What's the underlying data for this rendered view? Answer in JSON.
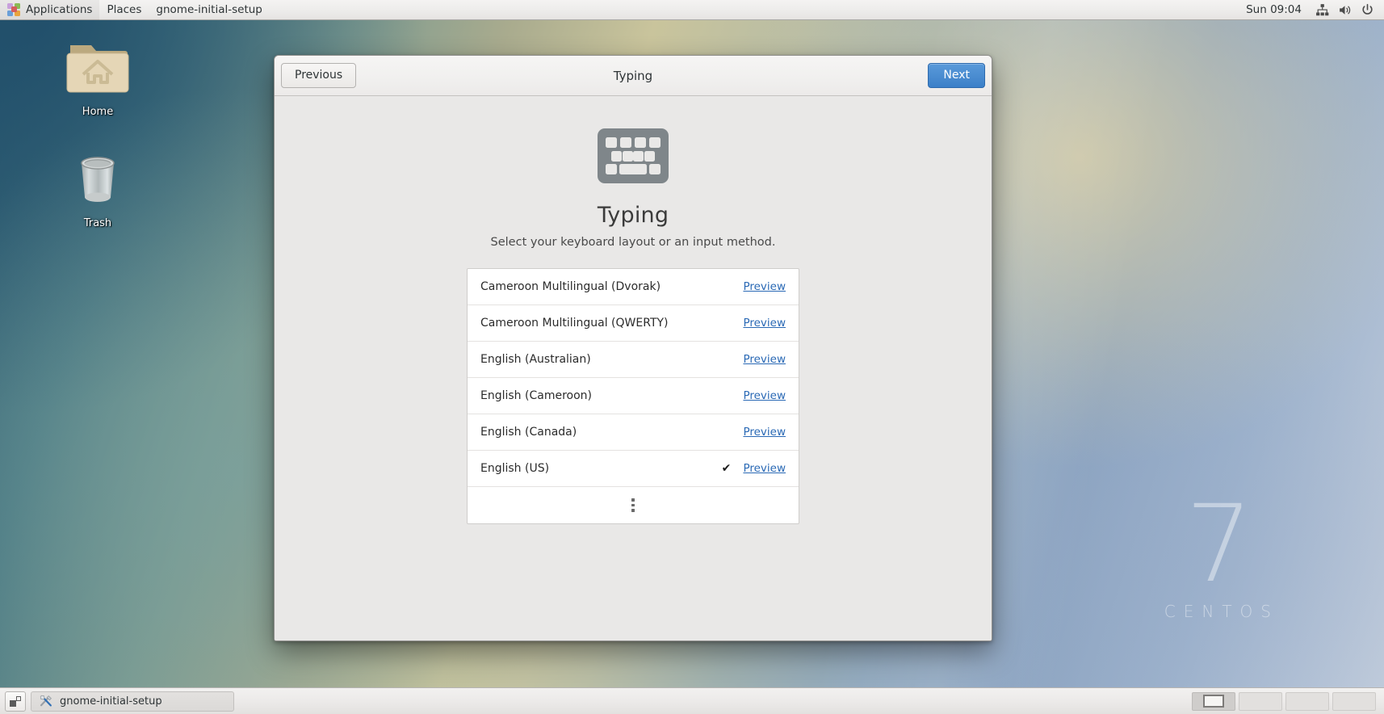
{
  "top_panel": {
    "applications_label": "Applications",
    "places_label": "Places",
    "window_menu_label": "gnome-initial-setup",
    "apps_icon": "gnome-foot-icon",
    "clock": "Sun 09:04",
    "tray": [
      {
        "name": "network-icon",
        "glyph": "network"
      },
      {
        "name": "volume-icon",
        "glyph": "volume"
      },
      {
        "name": "power-icon",
        "glyph": "power"
      }
    ]
  },
  "desktop": {
    "icons": [
      {
        "name": "home-folder-icon",
        "label": "Home"
      },
      {
        "name": "trash-icon",
        "label": "Trash"
      }
    ],
    "watermark": {
      "version": "7",
      "distro": "CENTOS"
    }
  },
  "setup_window": {
    "title": "Typing",
    "previous_label": "Previous",
    "next_label": "Next",
    "accent_color": "#3c80c8",
    "page": {
      "icon": "keyboard-icon",
      "heading": "Typing",
      "subheading": "Select your keyboard layout or an input method.",
      "preview_label": "Preview",
      "check_glyph": "✔",
      "layouts": [
        {
          "label": "Cameroon Multilingual (Dvorak)",
          "selected": false
        },
        {
          "label": "Cameroon Multilingual (QWERTY)",
          "selected": false
        },
        {
          "label": "English (Australian)",
          "selected": false
        },
        {
          "label": "English (Cameroon)",
          "selected": false
        },
        {
          "label": "English (Canada)",
          "selected": false
        },
        {
          "label": "English (US)",
          "selected": true
        }
      ],
      "more_row": {
        "name": "show-more-layouts",
        "glyph": "vertical-ellipsis"
      }
    }
  },
  "bottom_panel": {
    "show_desktop_name": "show-desktop-button",
    "task_label": "gnome-initial-setup",
    "task_icon": "tools-icon",
    "workspaces": [
      {
        "active": true
      },
      {
        "active": false
      },
      {
        "active": false
      },
      {
        "active": false
      }
    ]
  }
}
